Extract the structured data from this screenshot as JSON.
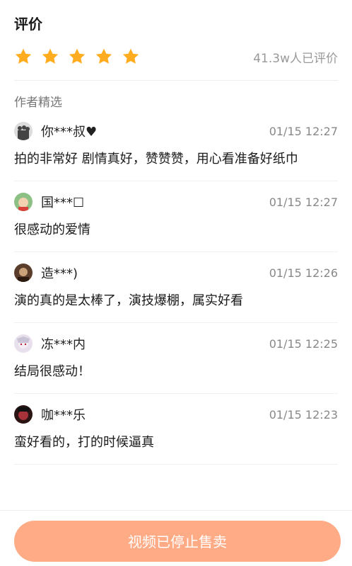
{
  "header": {
    "title": "评价"
  },
  "rating": {
    "stars": 5,
    "star_color": "#ffad1f",
    "count_text": "41.3w人已评价"
  },
  "section": {
    "title": "作者精选"
  },
  "comments": [
    {
      "user": "你***叔♥",
      "time": "01/15 12:27",
      "text": "拍的非常好 剧情真好，赞赞赞，用心看准备好纸巾",
      "avatar_color": "#444444"
    },
    {
      "user": "国***☐",
      "time": "01/15 12:27",
      "text": "很感动的爱情",
      "avatar_color": "#7fb069"
    },
    {
      "user": "造***)",
      "time": "01/15 12:26",
      "text": "演的真的是太棒了，演技爆棚，属实好看",
      "avatar_color": "#5a3e2b"
    },
    {
      "user": "冻***内",
      "time": "01/15 12:25",
      "text": "结局很感动！",
      "avatar_color": "#b89bb8"
    },
    {
      "user": "咖***乐",
      "time": "01/15 12:23",
      "text": "蛮好看的，打的时候逼真",
      "avatar_color": "#3a1a1a"
    }
  ],
  "bottom": {
    "button_label": "视频已停止售卖",
    "button_color": "#ffab86"
  }
}
